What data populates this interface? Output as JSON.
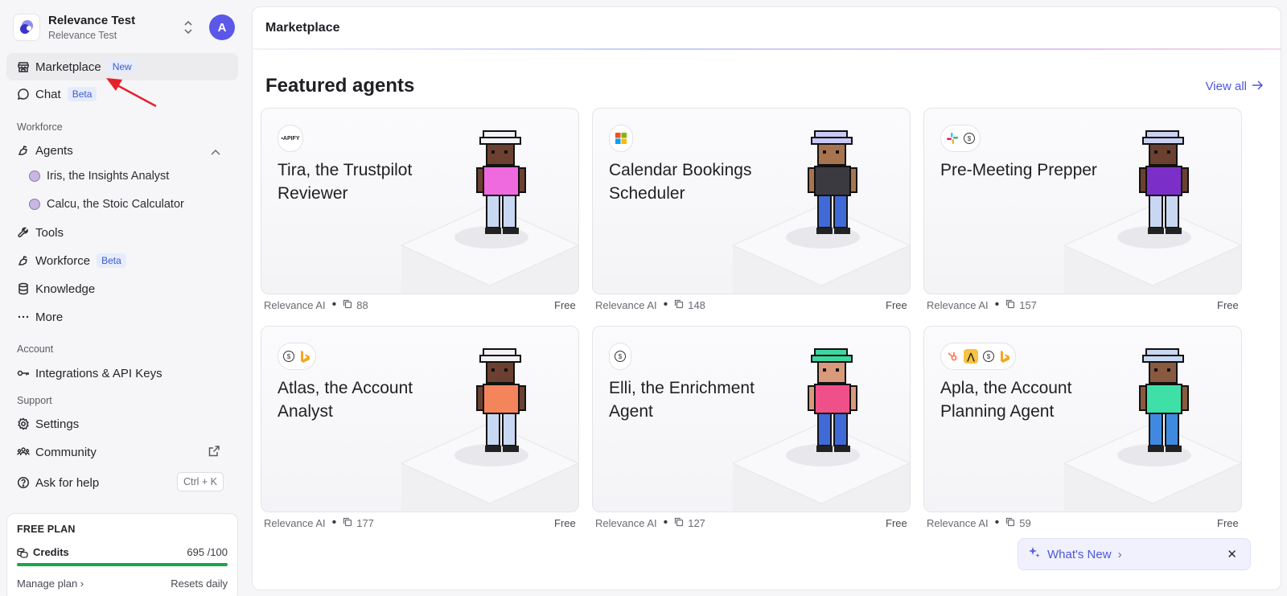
{
  "workspace": {
    "name": "Relevance Test",
    "sub": "Relevance Test",
    "avatar_letter": "A"
  },
  "nav": {
    "marketplace": {
      "label": "Marketplace",
      "badge": "New"
    },
    "chat": {
      "label": "Chat",
      "badge": "Beta"
    },
    "workforce_section": "Workforce",
    "agents": {
      "label": "Agents"
    },
    "agent_items": [
      "Iris, the Insights Analyst",
      "Calcu, the Stoic Calculator"
    ],
    "tools": "Tools",
    "workforce": {
      "label": "Workforce",
      "badge": "Beta"
    },
    "knowledge": "Knowledge",
    "more": "More",
    "account_section": "Account",
    "integrations": "Integrations & API Keys",
    "support_section": "Support",
    "settings": "Settings",
    "community": "Community",
    "ask_help": "Ask for help",
    "ask_shortcut": "Ctrl + K"
  },
  "plan": {
    "title": "FREE PLAN",
    "credits_label": "Credits",
    "credits_value": "695 /100",
    "credits_fill": 1.0,
    "manage": "Manage plan",
    "resets": "Resets daily"
  },
  "main": {
    "header": "Marketplace",
    "section_title": "Featured agents",
    "view_all": "View all"
  },
  "cards": [
    {
      "title": "Tira, the Trustpilot Reviewer",
      "author": "Relevance AI",
      "clones": "88",
      "price": "Free",
      "icons": [
        "apify-icon"
      ],
      "shirt": "#f06adf",
      "pants": "#c9d8f2",
      "skin": "#6b4030",
      "hat": "#f2f2f7"
    },
    {
      "title": "Calendar Bookings Scheduler",
      "author": "Relevance AI",
      "clones": "148",
      "price": "Free",
      "icons": [
        "microsoft-icon"
      ],
      "shirt": "#3a3a40",
      "pants": "#3f6ad8",
      "skin": "#a8744f",
      "hat": "#c9c9f5"
    },
    {
      "title": "Pre-Meeting Prepper",
      "author": "Relevance AI",
      "clones": "157",
      "price": "Free",
      "icons": [
        "slack-icon",
        "dollar-circle-icon"
      ],
      "shirt": "#7b2fc8",
      "pants": "#c9d8f2",
      "skin": "#6b4030",
      "hat": "#c9d2f2"
    },
    {
      "title": "Atlas, the Account Analyst",
      "author": "Relevance AI",
      "clones": "177",
      "price": "Free",
      "icons": [
        "dollar-circle-icon",
        "bing-icon"
      ],
      "shirt": "#f4845c",
      "pants": "#c9d8f2",
      "skin": "#6b4030",
      "hat": "#f2f2f7"
    },
    {
      "title": "Elli, the Enrichment Agent",
      "author": "Relevance AI",
      "clones": "127",
      "price": "Free",
      "icons": [
        "dollar-circle-icon"
      ],
      "shirt": "#f0508a",
      "pants": "#3f6ad8",
      "skin": "#d99a7c",
      "hat": "#3ed6a0"
    },
    {
      "title": "Apla, the Account Planning Agent",
      "author": "Relevance AI",
      "clones": "59",
      "price": "Free",
      "icons": [
        "hubspot-icon",
        "apollo-icon",
        "dollar-circle-icon",
        "bing-icon"
      ],
      "shirt": "#3ee0a8",
      "pants": "#3f8ae0",
      "skin": "#8a5a40",
      "hat": "#c9d8f2"
    }
  ],
  "whats_new": {
    "label": "What's New"
  },
  "colors": {
    "accent": "#4e56d8",
    "badge_bg": "#e6ecfb",
    "progress": "#1aa54a",
    "annotation": "#e5212c"
  }
}
